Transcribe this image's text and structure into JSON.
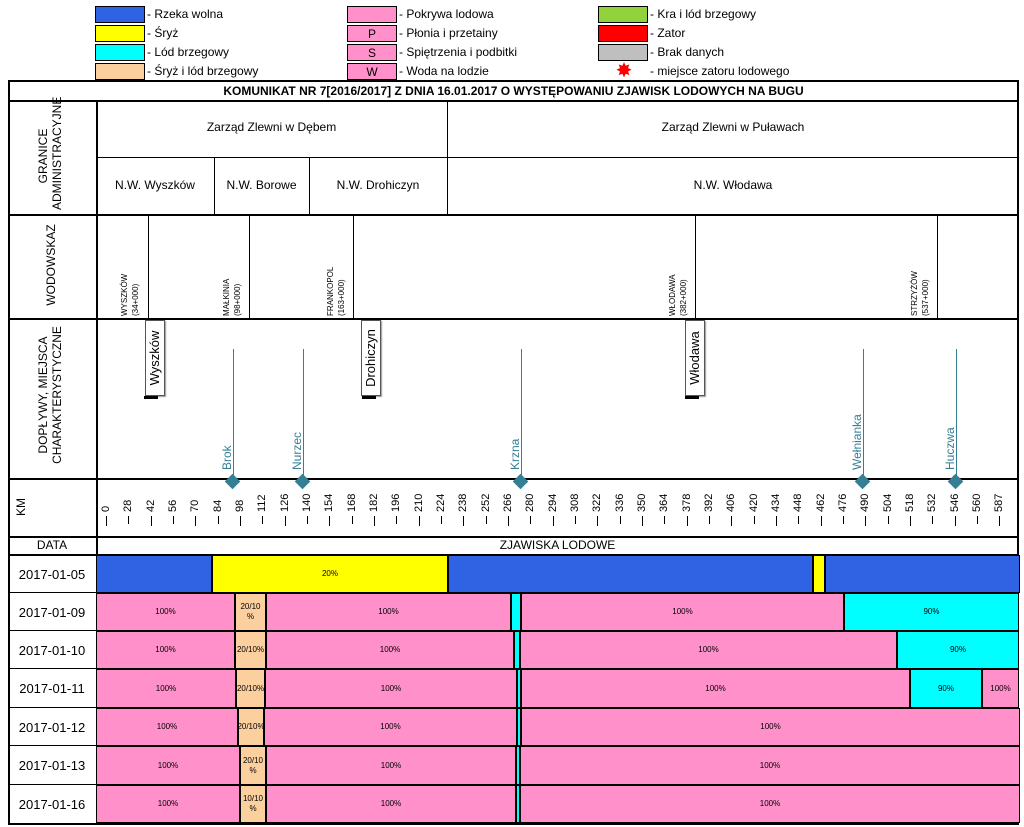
{
  "colors": {
    "free": "#2f63e4",
    "frazil": "#ffff00",
    "shore": "#00ffff",
    "frazil_shore": "#fbcf9e",
    "ice_cover": "#ff90c9",
    "floe_shore": "#91d33c",
    "jam": "#ff0000",
    "nodata": "#bfbfbf",
    "tributary": "#357f94",
    "black": "#000000"
  },
  "legend": [
    {
      "key": "free",
      "symbol": "",
      "label": "- Rzeka wolna"
    },
    {
      "key": "frazil",
      "symbol": "",
      "label": "- Śryż"
    },
    {
      "key": "shore",
      "symbol": "",
      "label": "- Lód brzegowy"
    },
    {
      "key": "frazil_shore",
      "symbol": "",
      "label": "- Śryż i lód brzegowy"
    },
    {
      "key": "ice_cover",
      "symbol": "",
      "label": "- Pokrywa lodowa"
    },
    {
      "key": "ice_cover",
      "symbol": "P",
      "label": "- Płonia i przetainy"
    },
    {
      "key": "ice_cover",
      "symbol": "S",
      "label": "- Spiętrzenia i podbitki"
    },
    {
      "key": "ice_cover",
      "symbol": "W",
      "label": "- Woda na lodzie"
    },
    {
      "key": "floe_shore",
      "symbol": "",
      "label": "- Kra i lód brzegowy"
    },
    {
      "key": "jam",
      "symbol": "",
      "label": "- Zator"
    },
    {
      "key": "nodata",
      "symbol": "",
      "label": "- Brak danych"
    },
    {
      "key": "star",
      "symbol": "",
      "label": "- miejsce zatoru lodowego"
    }
  ],
  "title": "KOMUNIKAT NR 7[2016/2017] Z DNIA 16.01.2017 O WYSTĘPOWANIU ZJAWISK LODOWYCH NA BUGU",
  "sections": {
    "granice": "GRANICE ADMINISTRACYJNE",
    "wodowskaz": "WODOWSKAZ",
    "doplywy": "DOPŁYWY, MIEJSCA CHARAKTERYSTYCZNE",
    "km": "KM",
    "data": "DATA",
    "zjawiska": "ZJAWISKA LODOWE"
  },
  "zarzady": [
    "Zarząd Zlewni w Dębem",
    "Zarząd Zlewni w Puławach"
  ],
  "nadzory": [
    "N.W. Wyszków",
    "N.W. Borowe",
    "N.W. Drohiczyn",
    "N.W. Włodawa"
  ],
  "gauges": [
    {
      "name": "WYSZKÓW",
      "km": "(34+000)"
    },
    {
      "name": "MAŁKINIA",
      "km": "(98+000)"
    },
    {
      "name": "FRANKOPOL",
      "km": "(163+000)"
    },
    {
      "name": "WŁODAWA",
      "km": "(382+000)"
    },
    {
      "name": "STRZYŻÓW",
      "km": "(537+000)"
    }
  ],
  "towns": [
    "Wyszków",
    "Drohiczyn",
    "Włodawa"
  ],
  "tributaries": [
    "Brok",
    "Nurzec",
    "Krzna",
    "Wełnianka",
    "Huczwa"
  ],
  "km_ticks": [
    "0",
    "28",
    "42",
    "56",
    "70",
    "84",
    "98",
    "112",
    "126",
    "140",
    "154",
    "168",
    "182",
    "196",
    "210",
    "224",
    "238",
    "252",
    "266",
    "280",
    "294",
    "308",
    "322",
    "336",
    "350",
    "364",
    "378",
    "392",
    "406",
    "420",
    "434",
    "448",
    "462",
    "476",
    "490",
    "504",
    "518",
    "532",
    "546",
    "560",
    "587"
  ],
  "rows": [
    {
      "date": "2017-01-05",
      "segments": [
        {
          "c": "free",
          "t": ""
        },
        {
          "c": "frazil",
          "t": "20%"
        },
        {
          "c": "free",
          "t": ""
        },
        {
          "c": "frazil",
          "t": ""
        },
        {
          "c": "free",
          "t": ""
        }
      ]
    },
    {
      "date": "2017-01-09",
      "segments": [
        {
          "c": "ice_cover",
          "t": "100%"
        },
        {
          "c": "frazil_shore",
          "t": "20/10 %"
        },
        {
          "c": "ice_cover",
          "t": "100%"
        },
        {
          "c": "shore",
          "t": ""
        },
        {
          "c": "ice_cover",
          "t": "100%"
        },
        {
          "c": "shore",
          "t": "90%"
        }
      ]
    },
    {
      "date": "2017-01-10",
      "segments": [
        {
          "c": "ice_cover",
          "t": "100%"
        },
        {
          "c": "frazil_shore",
          "t": "20/10%"
        },
        {
          "c": "ice_cover",
          "t": "100%"
        },
        {
          "c": "shore",
          "t": ""
        },
        {
          "c": "ice_cover",
          "t": "100%"
        },
        {
          "c": "shore",
          "t": "90%"
        }
      ]
    },
    {
      "date": "2017-01-11",
      "segments": [
        {
          "c": "ice_cover",
          "t": "100%"
        },
        {
          "c": "frazil_shore",
          "t": "20/10%"
        },
        {
          "c": "ice_cover",
          "t": "100%"
        },
        {
          "c": "shore",
          "t": ""
        },
        {
          "c": "ice_cover",
          "t": "100%"
        },
        {
          "c": "shore",
          "t": "90%"
        },
        {
          "c": "ice_cover",
          "t": "100%"
        }
      ]
    },
    {
      "date": "2017-01-12",
      "segments": [
        {
          "c": "ice_cover",
          "t": "100%"
        },
        {
          "c": "frazil_shore",
          "t": "20/10%"
        },
        {
          "c": "ice_cover",
          "t": "100%"
        },
        {
          "c": "shore",
          "t": ""
        },
        {
          "c": "ice_cover",
          "t": "100%"
        }
      ]
    },
    {
      "date": "2017-01-13",
      "segments": [
        {
          "c": "ice_cover",
          "t": "100%"
        },
        {
          "c": "frazil_shore",
          "t": "20/10 %"
        },
        {
          "c": "ice_cover",
          "t": "100%"
        },
        {
          "c": "shore",
          "t": ""
        },
        {
          "c": "ice_cover",
          "t": "100%"
        }
      ]
    },
    {
      "date": "2017-01-16",
      "segments": [
        {
          "c": "ice_cover",
          "t": "100%"
        },
        {
          "c": "frazil_shore",
          "t": "10/10 %"
        },
        {
          "c": "ice_cover",
          "t": "100%"
        },
        {
          "c": "shore",
          "t": ""
        },
        {
          "c": "ice_cover",
          "t": "100%"
        }
      ]
    }
  ]
}
